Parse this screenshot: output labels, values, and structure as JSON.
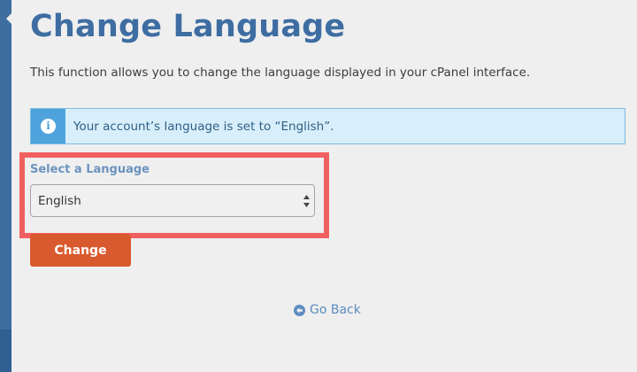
{
  "page": {
    "title": "Change Language",
    "description": "This function allows you to change the language displayed in your cPanel interface."
  },
  "alert": {
    "icon": "info-icon",
    "icon_glyph": "i",
    "text": "Your account’s language is set to “English”."
  },
  "language_select": {
    "label": "Select a Language",
    "selected": "English"
  },
  "actions": {
    "change_label": "Change",
    "go_back_label": "Go Back"
  },
  "colors": {
    "title": "#3e6da2",
    "button": "#d95a2e",
    "highlight": "#f06060",
    "alert_bg": "#d8eefa"
  }
}
